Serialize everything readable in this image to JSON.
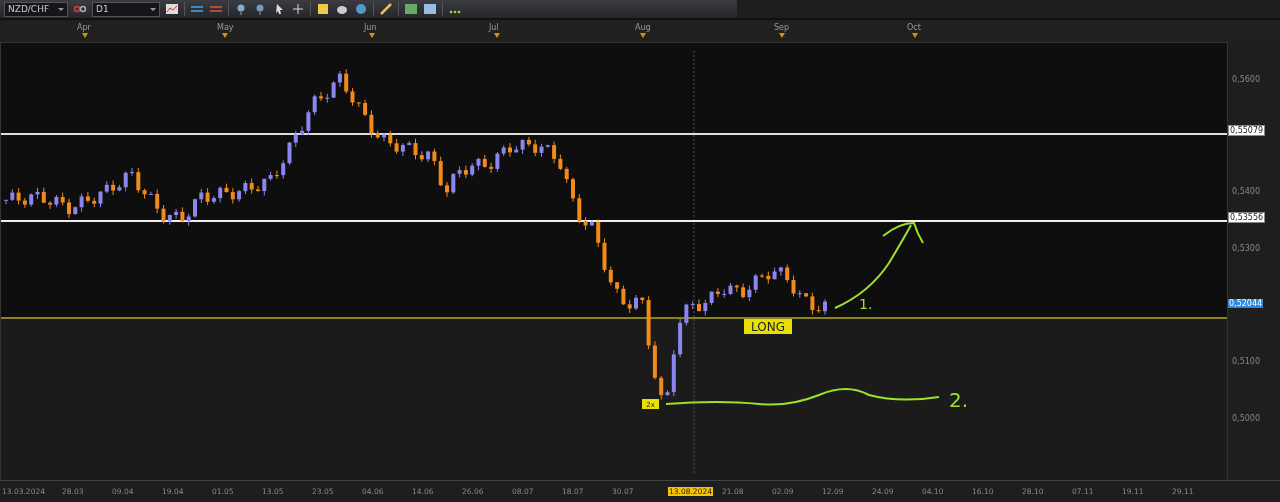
{
  "toolbar": {
    "symbol": "NZD/CHF",
    "timeframe": "D1"
  },
  "month_axis": [
    "Apr",
    "May",
    "Jun",
    "Jul",
    "Aug",
    "Sep",
    "Oct"
  ],
  "price_ticks": [
    "0,5600",
    "0,5400",
    "0,5300",
    "0,5100",
    "0,5000"
  ],
  "price_labels": [
    {
      "kind": "level",
      "text": "0,55079"
    },
    {
      "kind": "level",
      "text": "0,53556"
    },
    {
      "kind": "current",
      "text": "0,52044"
    }
  ],
  "date_axis": [
    {
      "text": "13.03.2024",
      "selected": false
    },
    {
      "text": "28.03",
      "selected": false
    },
    {
      "text": "09.04",
      "selected": false
    },
    {
      "text": "19.04",
      "selected": false
    },
    {
      "text": "01.05",
      "selected": false
    },
    {
      "text": "13.05",
      "selected": false
    },
    {
      "text": "23.05",
      "selected": false
    },
    {
      "text": "04.06",
      "selected": false
    },
    {
      "text": "14.06",
      "selected": false
    },
    {
      "text": "26.06",
      "selected": false
    },
    {
      "text": "08.07",
      "selected": false
    },
    {
      "text": "18.07",
      "selected": false
    },
    {
      "text": "30.07",
      "selected": false
    },
    {
      "text": "13.08.2024",
      "selected": true
    },
    {
      "text": "21.08",
      "selected": false
    },
    {
      "text": "02.09",
      "selected": false
    },
    {
      "text": "12.09",
      "selected": false
    },
    {
      "text": "24.09",
      "selected": false
    },
    {
      "text": "04.10",
      "selected": false
    },
    {
      "text": "16.10",
      "selected": false
    },
    {
      "text": "28.10",
      "selected": false
    },
    {
      "text": "07.11",
      "selected": false
    },
    {
      "text": "19.11",
      "selected": false
    },
    {
      "text": "29.11",
      "selected": false
    }
  ],
  "chart": {
    "signal_label": "LONG",
    "multiplier_label": "2x",
    "note_1": "1.",
    "note_2": "2."
  }
}
